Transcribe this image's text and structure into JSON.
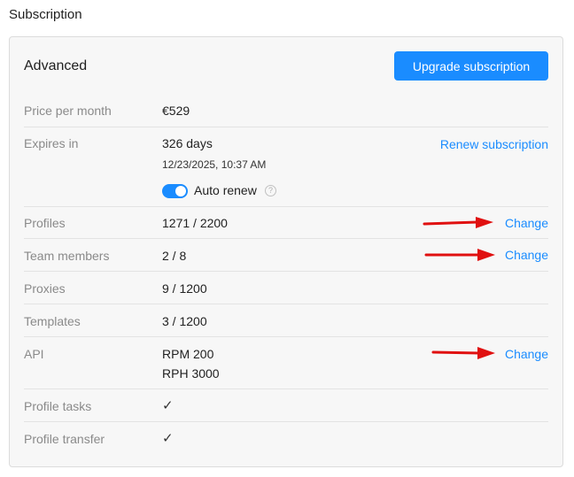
{
  "section_title": "Subscription",
  "plan": {
    "name": "Advanced",
    "upgrade_label": "Upgrade subscription"
  },
  "rows": {
    "price": {
      "label": "Price per month",
      "value": "€529"
    },
    "expires": {
      "label": "Expires in",
      "value": "326 days",
      "date": "12/23/2025, 10:37 AM",
      "action": "Renew subscription",
      "auto_renew_label": "Auto renew",
      "auto_renew_on": true,
      "help_icon": "question-circle-icon"
    },
    "profiles": {
      "label": "Profiles",
      "value": "1271 / 2200",
      "action": "Change"
    },
    "team": {
      "label": "Team members",
      "value": "2 / 8",
      "action": "Change"
    },
    "proxies": {
      "label": "Proxies",
      "value": "9 / 1200"
    },
    "templates": {
      "label": "Templates",
      "value": "3 / 1200"
    },
    "api": {
      "label": "API",
      "value_rpm": "RPM 200",
      "value_rph": "RPH 3000",
      "action": "Change"
    },
    "profile_tasks": {
      "label": "Profile tasks",
      "value_icon": "checkmark-icon"
    },
    "profile_transfer": {
      "label": "Profile transfer",
      "value_icon": "checkmark-icon"
    }
  },
  "colors": {
    "accent": "#1a8cff",
    "annotation_arrow": "#e01010"
  }
}
